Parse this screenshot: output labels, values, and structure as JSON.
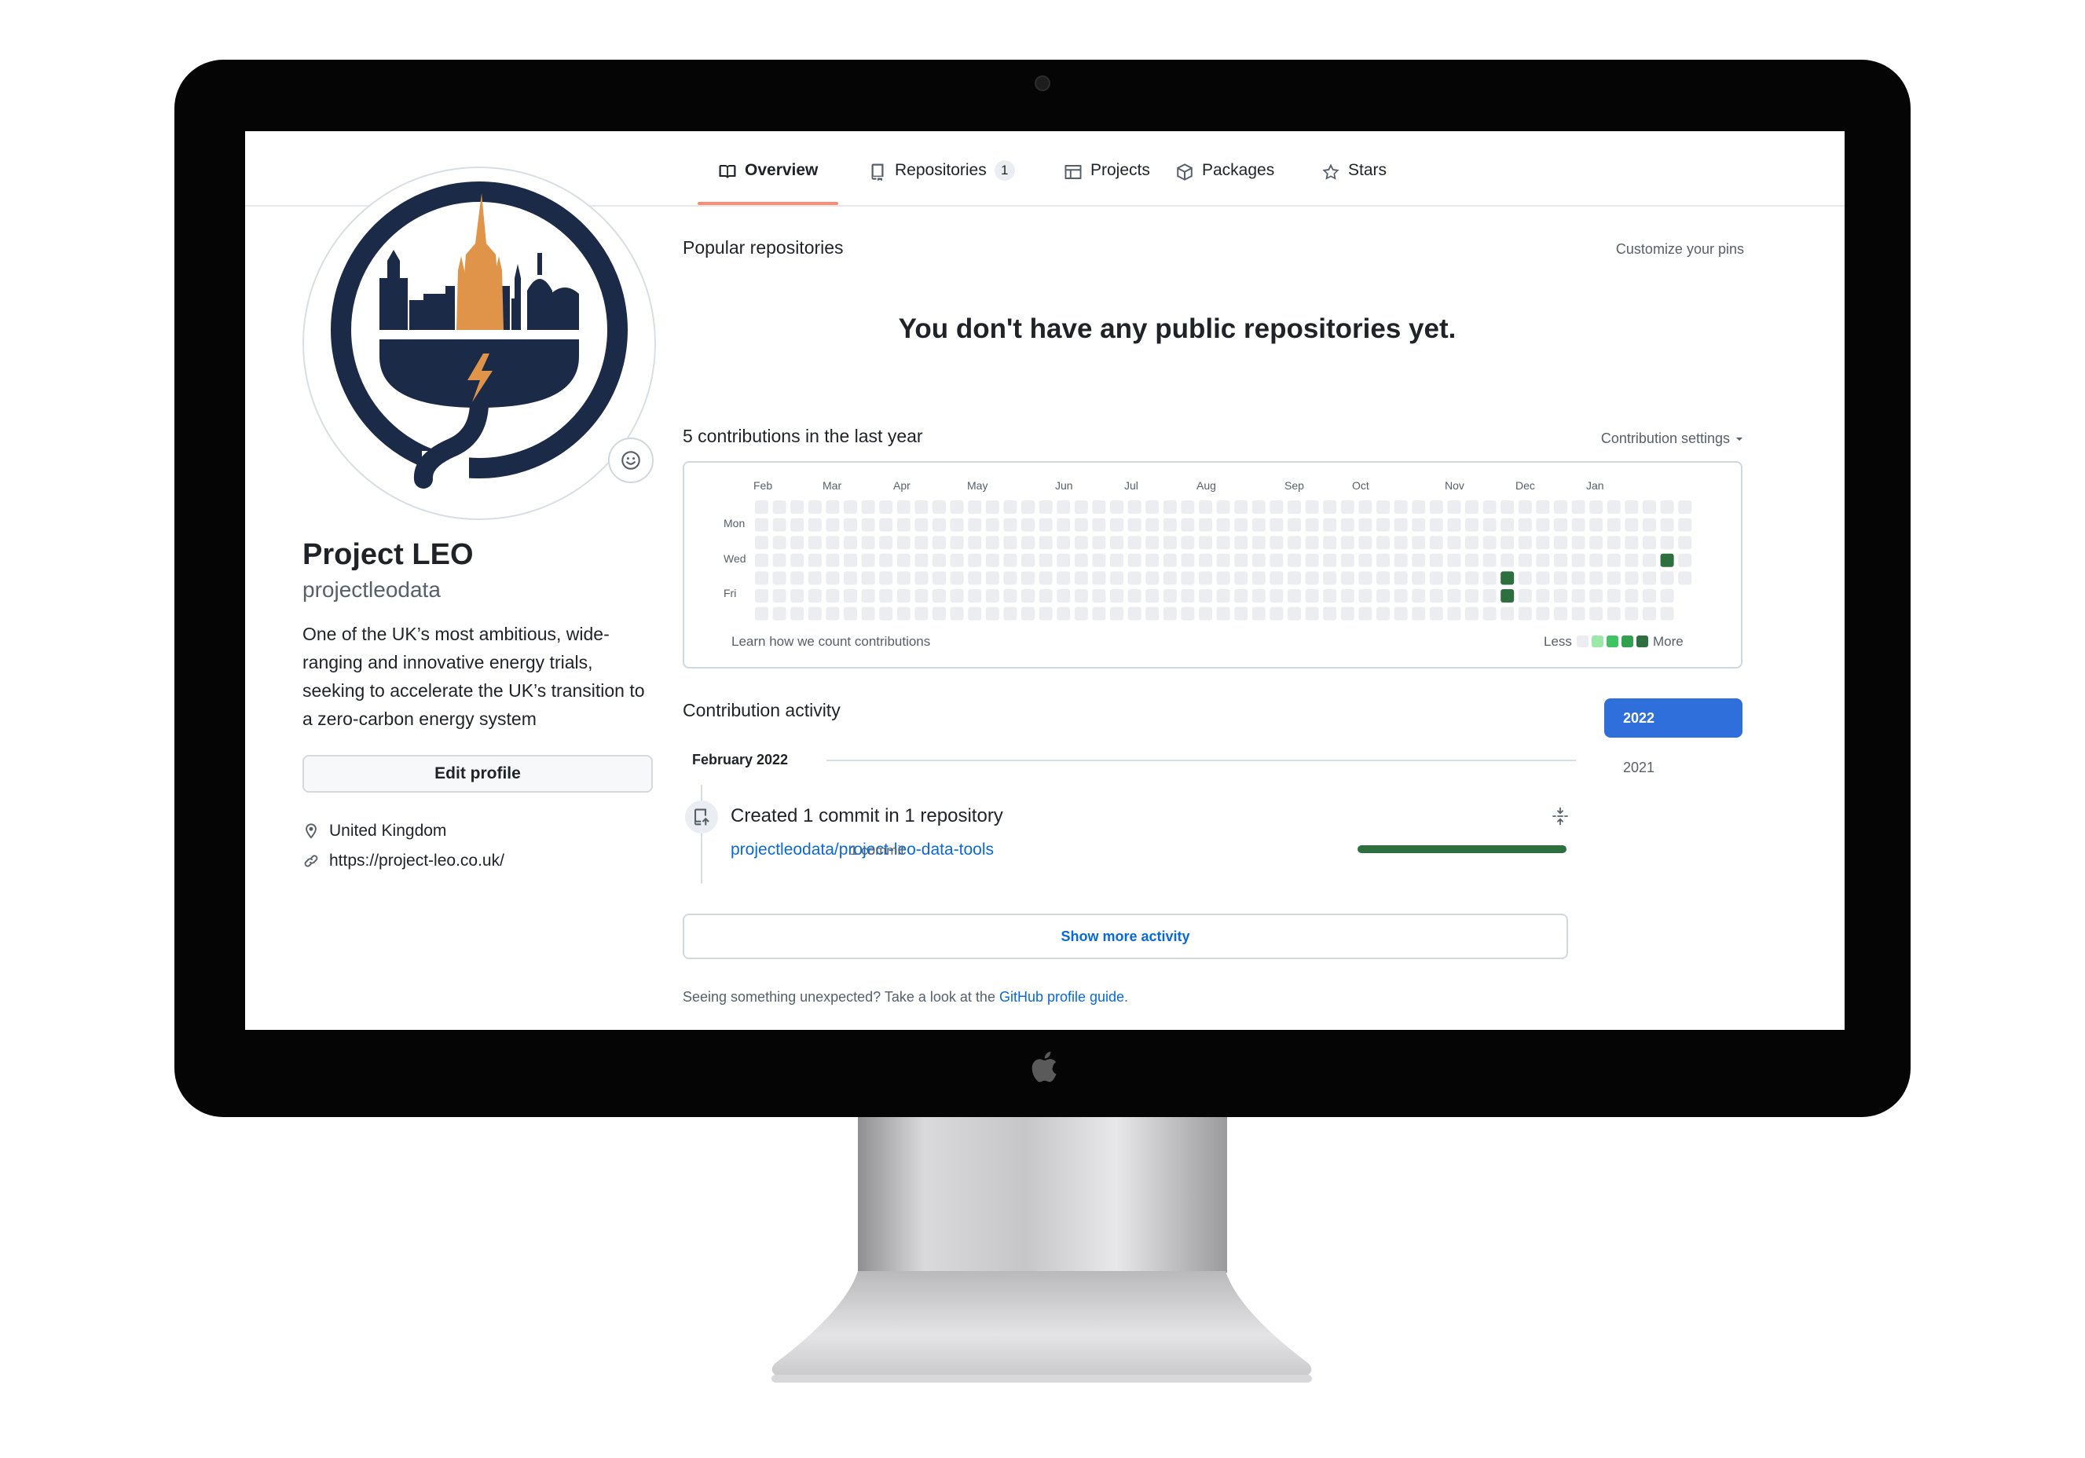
{
  "tabs": [
    {
      "label": "Overview",
      "icon": "book-icon",
      "active": true
    },
    {
      "label": "Repositories",
      "icon": "repo-icon",
      "count": "1"
    },
    {
      "label": "Projects",
      "icon": "table-icon"
    },
    {
      "label": "Packages",
      "icon": "package-icon"
    },
    {
      "label": "Stars",
      "icon": "star-icon"
    }
  ],
  "profile": {
    "name": "Project LEO",
    "login": "projectleodata",
    "bio": "One of the UK’s most ambitious, wide-ranging and innovative energy trials, seeking to accelerate the UK’s transition to a zero-carbon energy system",
    "edit_label": "Edit profile",
    "location": "United Kingdom",
    "website": "https://project-leo.co.uk/"
  },
  "popular": {
    "title": "Popular repositories",
    "customize": "Customize your pins",
    "empty": "You don't have any public repositories yet."
  },
  "contributions": {
    "title": "5 contributions in the last year",
    "settings": "Contribution settings",
    "months": [
      "Feb",
      "Mar",
      "Apr",
      "May",
      "Jun",
      "Jul",
      "Aug",
      "Sep",
      "Oct",
      "Nov",
      "Dec",
      "Jan"
    ],
    "days": [
      "Mon",
      "Wed",
      "Fri"
    ],
    "learn": "Learn how we count contributions",
    "less": "Less",
    "more": "More",
    "colors": {
      "empty": "#ebedf0",
      "l1": "#9be9a8",
      "l2": "#40c463",
      "l3": "#30a14e",
      "l4": "#2e6f40"
    }
  },
  "activity": {
    "title": "Contribution activity",
    "years": [
      "2022",
      "2021"
    ],
    "month": "February 2022",
    "item_title": "Created 1 commit in 1 repository",
    "repo": "projectleodata/project-leo-data-tools",
    "commits": "1 commit",
    "show_more": "Show more activity",
    "footer_prefix": "Seeing something unexpected? Take a look at the ",
    "footer_link": "GitHub profile guide",
    "footer_suffix": "."
  }
}
